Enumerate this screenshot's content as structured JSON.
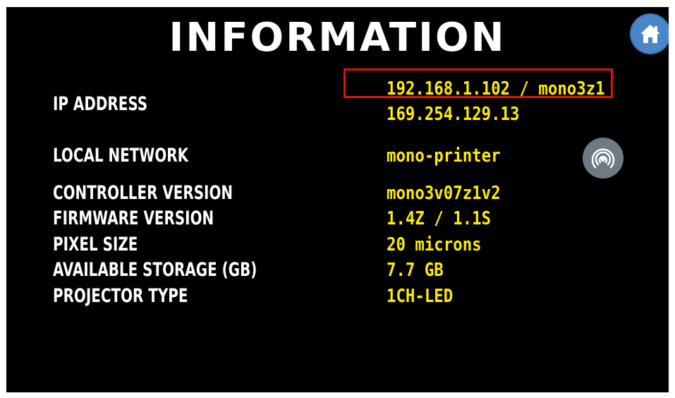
{
  "screen": {
    "title": "INFORMATION"
  },
  "home_button": {
    "icon": "home-icon"
  },
  "network_button": {
    "icon": "wifi-hotspot-icon"
  },
  "info": {
    "ip_address": {
      "label": "IP ADDRESS",
      "value_primary": "192.168.1.102 / mono3z1",
      "value_secondary": "169.254.129.13"
    },
    "local_network": {
      "label": "LOCAL NETWORK",
      "value": "mono-printer"
    },
    "controller_version": {
      "label": "CONTROLLER VERSION",
      "value": "mono3v07z1v2"
    },
    "firmware_version": {
      "label": "FIRMWARE VERSION",
      "value": "1.4Z / 1.1S"
    },
    "pixel_size": {
      "label": "PIXEL SIZE",
      "value": "20 microns"
    },
    "available_storage": {
      "label": "AVAILABLE STORAGE (GB)",
      "value": "7.7 GB"
    },
    "projector_type": {
      "label": "PROJECTOR TYPE",
      "value": "1CH-LED"
    }
  },
  "colors": {
    "background": "#000000",
    "label": "#ffffff",
    "value": "#ffec00",
    "highlight": "#e31010",
    "home_button": "#4a86c8",
    "network_button": "#6e7a84"
  }
}
